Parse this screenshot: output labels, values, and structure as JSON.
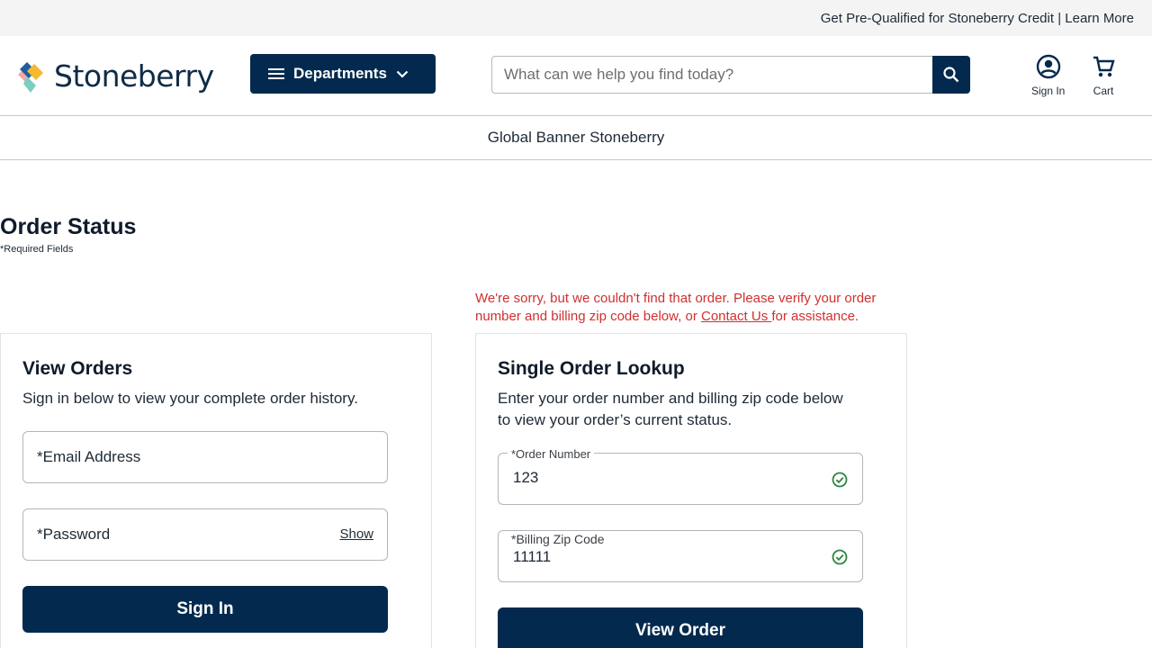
{
  "promo": {
    "text": "Get Pre-Qualified for Stoneberry Credit",
    "separator": "|",
    "link": "Learn More"
  },
  "header": {
    "logo_text": "Stoneberry",
    "departments_label": "Departments",
    "search_placeholder": "What can we help you find today?",
    "sign_in_label": "Sign In",
    "cart_label": "Cart"
  },
  "global_banner": "Global Banner Stoneberry",
  "page": {
    "title": "Order Status",
    "required_note": "*Required Fields"
  },
  "error": {
    "text_before": "We're sorry, but we couldn't find that order. Please verify your order number and billing zip code below, or ",
    "link": "Contact Us ",
    "text_after": "for assistance."
  },
  "view_orders": {
    "title": "View Orders",
    "description": "Sign in below to view your complete order history.",
    "email_placeholder": "*Email Address",
    "password_placeholder": "*Password",
    "show_label": "Show",
    "button": "Sign In"
  },
  "single_lookup": {
    "title": "Single Order Lookup",
    "description": "Enter your order number and billing zip code below to view your order’s current status.",
    "order_label": "*Order Number",
    "order_value": "123",
    "zip_label": "*Billing Zip Code",
    "zip_value": "11111",
    "button": "View Order"
  },
  "colors": {
    "brand_navy": "#032a4e",
    "error_red": "#d12f2f",
    "valid_green": "#2e8540"
  }
}
